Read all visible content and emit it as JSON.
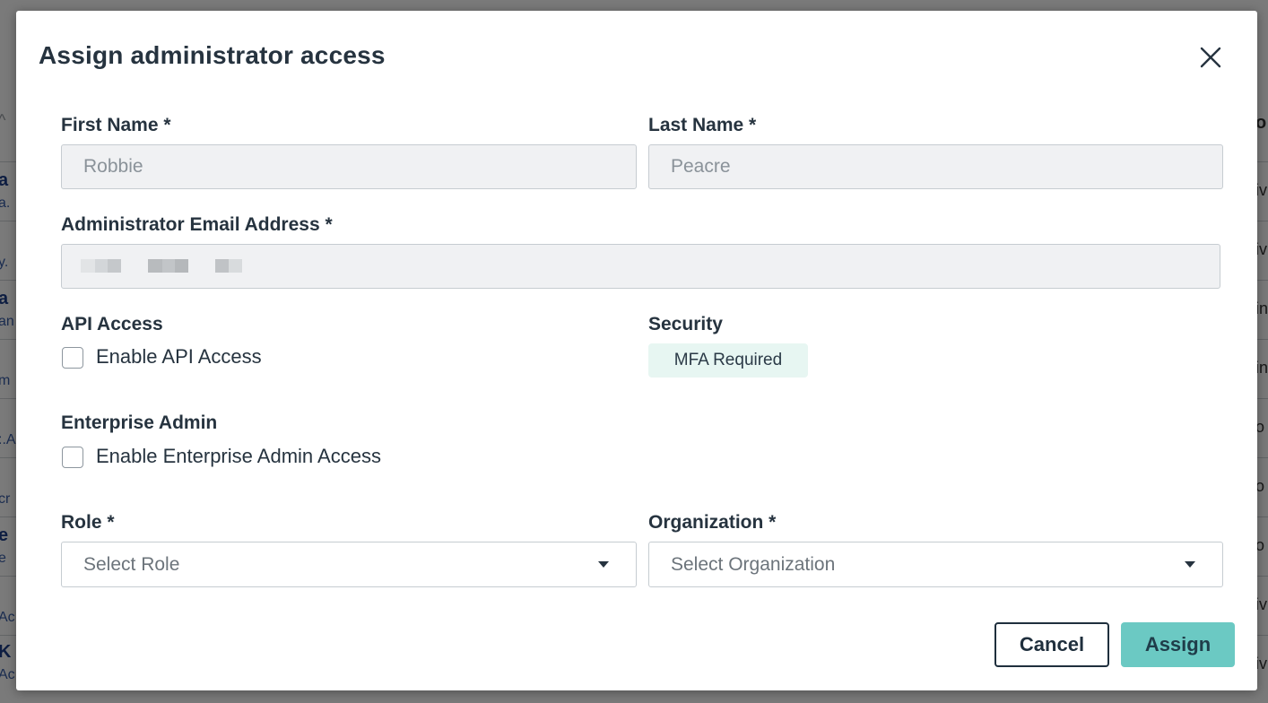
{
  "modal": {
    "title": "Assign administrator access",
    "close_icon": "close-icon"
  },
  "fields": {
    "first_name": {
      "label": "First Name *",
      "value": "Robbie"
    },
    "last_name": {
      "label": "Last Name *",
      "value": "Peacre"
    },
    "email": {
      "label": "Administrator Email Address *",
      "value": ""
    },
    "api_access": {
      "label": "API Access",
      "checkbox_label": "Enable API Access",
      "checked": false
    },
    "security": {
      "label": "Security",
      "badge": "MFA Required"
    },
    "enterprise_admin": {
      "label": "Enterprise Admin",
      "checkbox_label": "Enable Enterprise Admin Access",
      "checked": false
    },
    "role": {
      "label": "Role *",
      "placeholder": "Select Role"
    },
    "organization": {
      "label": "Organization *",
      "placeholder": "Select Organization"
    }
  },
  "actions": {
    "cancel": "Cancel",
    "assign": "Assign"
  },
  "colors": {
    "assign_button": "#6bc9c3",
    "badge_bg": "#e7f6f2",
    "input_disabled_bg": "#f0f1f3"
  }
}
